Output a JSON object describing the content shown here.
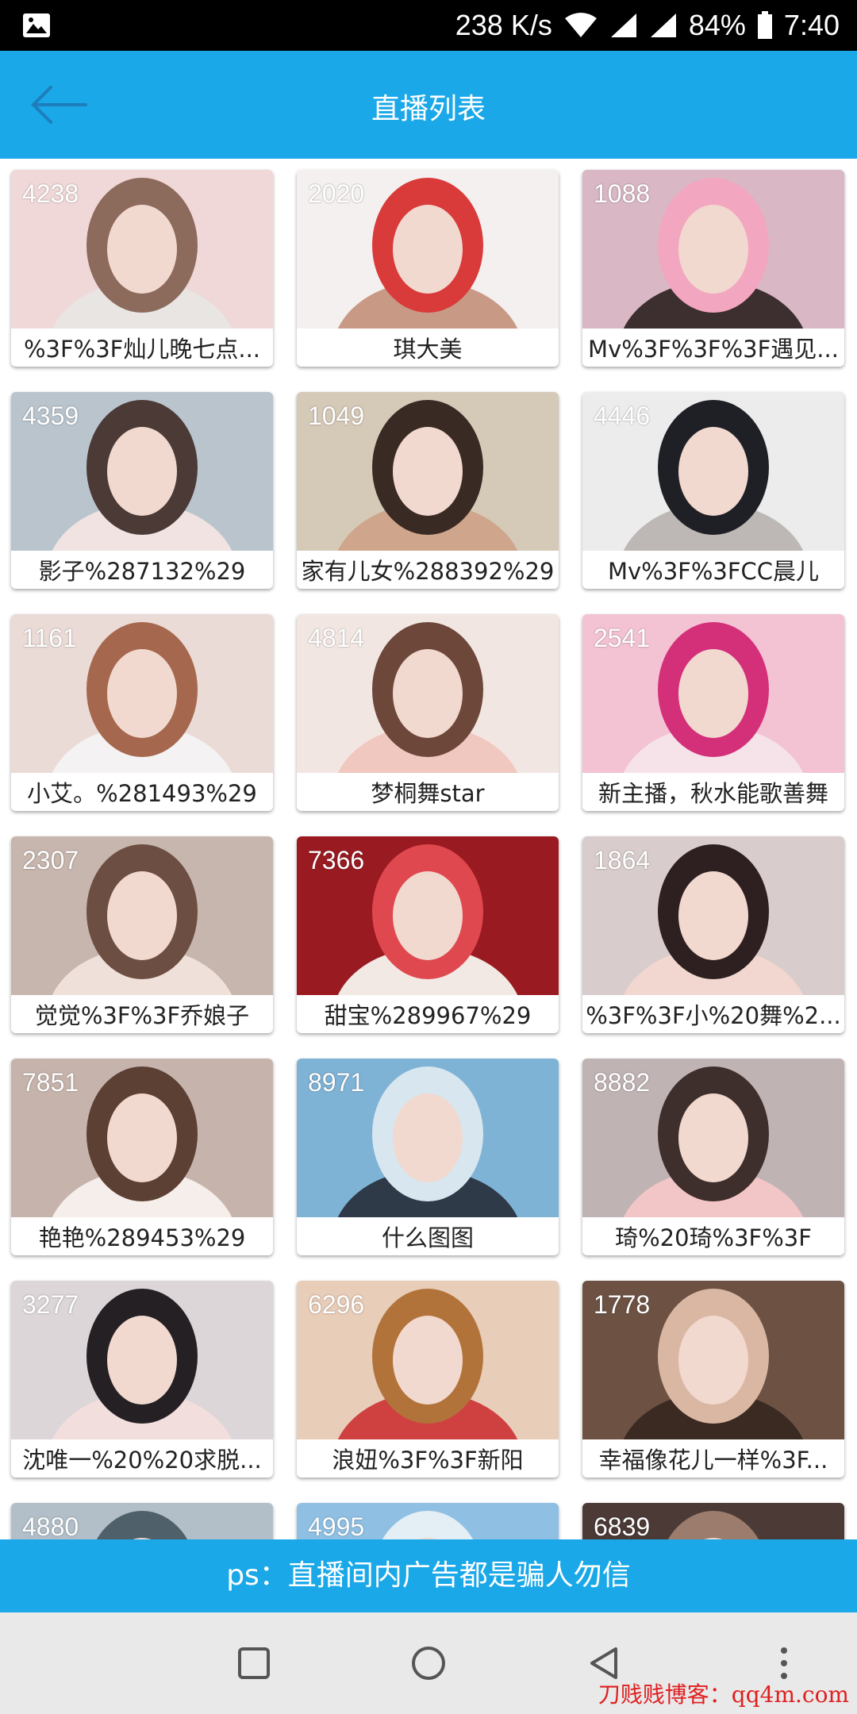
{
  "status_bar": {
    "gallery_icon": "image-icon",
    "speed": "238 K/s",
    "battery": "84%",
    "time": "7:40"
  },
  "header": {
    "back_icon": "arrow-left-icon",
    "title": "直播列表"
  },
  "streams": [
    {
      "count": "4238",
      "title": "%3F%3F灿儿晚七点...",
      "colors": [
        "#f0d8d8",
        "#8c6a5c",
        "#e9e5e3"
      ]
    },
    {
      "count": "2020",
      "title": "琪大美",
      "colors": [
        "#f4f0ef",
        "#d93a3a",
        "#c89a86"
      ]
    },
    {
      "count": "1088",
      "title": "Mv%3F%3F%3F遇见...",
      "colors": [
        "#d9b7c4",
        "#f3a6bf",
        "#3d2f2f"
      ]
    },
    {
      "count": "4359",
      "title": "影子%287132%29",
      "colors": [
        "#b9c4cc",
        "#4b3a36",
        "#f1e3e1"
      ]
    },
    {
      "count": "1049",
      "title": "家有儿女%288392%29",
      "colors": [
        "#d5c9b8",
        "#3a2a24",
        "#cfa58b"
      ]
    },
    {
      "count": "4446",
      "title": "Mv%3F%3FCC晨儿",
      "colors": [
        "#ececec",
        "#1f1f26",
        "#bdb8b5"
      ]
    },
    {
      "count": "1161",
      "title": "小艾。%281493%29",
      "colors": [
        "#eadbd6",
        "#a5674e",
        "#f4f2f2"
      ]
    },
    {
      "count": "4814",
      "title": "梦桐舞star",
      "colors": [
        "#f2e6e3",
        "#6d4739",
        "#f0c8c0"
      ]
    },
    {
      "count": "2541",
      "title": "新主播，秋水能歌善舞",
      "colors": [
        "#f3c3d4",
        "#d4307a",
        "#f6e3ea"
      ]
    },
    {
      "count": "2307",
      "title": "觉觉%3F%3F乔娘子",
      "colors": [
        "#c7b6ad",
        "#6d4e42",
        "#f0e0da"
      ]
    },
    {
      "count": "7366",
      "title": "甜宝%289967%29",
      "colors": [
        "#9a1a22",
        "#e04850",
        "#f3e9e4"
      ]
    },
    {
      "count": "1864",
      "title": "%3F%3F小%20舞%2...",
      "colors": [
        "#d9cccc",
        "#2e2020",
        "#f1d7cf"
      ]
    },
    {
      "count": "7851",
      "title": "艳艳%289453%29",
      "colors": [
        "#c6b4ac",
        "#5d4034",
        "#f6eeea"
      ]
    },
    {
      "count": "8971",
      "title": "什么图图",
      "colors": [
        "#7fb3d6",
        "#d8e6ef",
        "#2f3a49"
      ]
    },
    {
      "count": "8882",
      "title": "琦%20琦%3F%3F",
      "colors": [
        "#c0b3b4",
        "#3f2f2c",
        "#f2c6c7"
      ]
    },
    {
      "count": "3277",
      "title": "沈唯一%20%20求脱...",
      "colors": [
        "#dcd6d8",
        "#252024",
        "#f3dede"
      ]
    },
    {
      "count": "6296",
      "title": "浪妞%3F%3F新阳",
      "colors": [
        "#e8cdb8",
        "#b2733b",
        "#cf4040"
      ]
    },
    {
      "count": "1778",
      "title": "幸福像花儿一样%3F...",
      "colors": [
        "#6d5244",
        "#d9b7a3",
        "#3a2a22"
      ]
    },
    {
      "count": "4880",
      "title": "",
      "colors": [
        "#b3bfc8",
        "#50606b",
        "#e3e8ec"
      ]
    },
    {
      "count": "4995",
      "title": "",
      "colors": [
        "#8fc0e4",
        "#e4eef5",
        "#5a86a6"
      ]
    },
    {
      "count": "6839",
      "title": "",
      "colors": [
        "#4b3a35",
        "#9c7c6c",
        "#e6d6cf"
      ]
    }
  ],
  "notice": "ps：直播间内广告都是骗人勿信",
  "nav": {
    "recents_icon": "square-icon",
    "home_icon": "circle-icon",
    "back_icon": "triangle-back-icon",
    "menu_icon": "dots-icon"
  },
  "watermark": "刀贱贱博客：qq4m.com",
  "colors": {
    "accent": "#1aa8e8",
    "status_bar": "#000000",
    "nav_bar": "#e9e9ea"
  }
}
